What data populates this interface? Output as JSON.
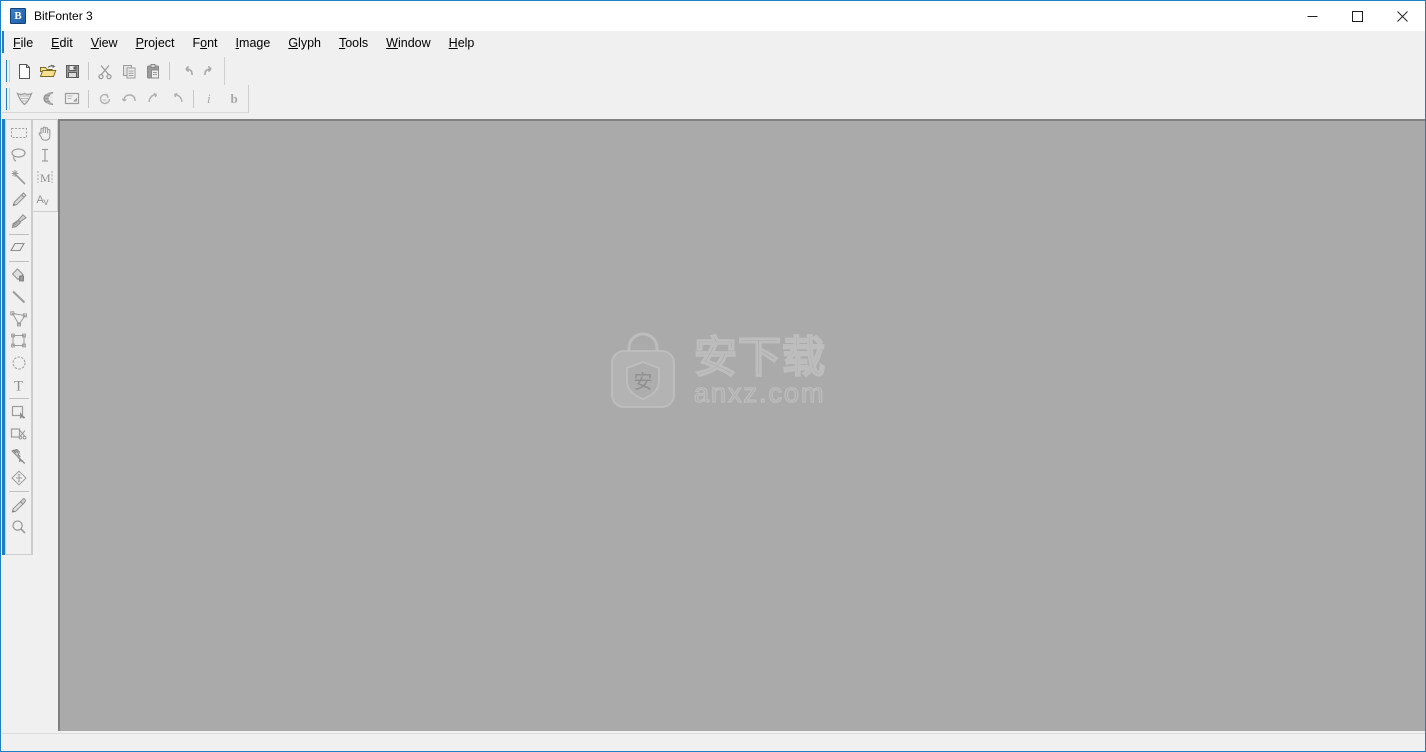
{
  "window": {
    "title": "BitFonter 3",
    "app_icon": "bitfonter-app-icon",
    "icon_letter": "B",
    "minimize_label": "Minimize",
    "maximize_label": "Maximize",
    "close_label": "Close",
    "accent_color": "#1f7fc4",
    "chrome_color": "#f0f0f0",
    "canvas_color": "#aaaaaa"
  },
  "menubar": {
    "items": [
      {
        "label": "File",
        "pre": "",
        "acc": "F",
        "post": "ile"
      },
      {
        "label": "Edit",
        "pre": "",
        "acc": "E",
        "post": "dit"
      },
      {
        "label": "View",
        "pre": "",
        "acc": "V",
        "post": "iew"
      },
      {
        "label": "Project",
        "pre": "",
        "acc": "P",
        "post": "roject"
      },
      {
        "label": "Font",
        "pre": "F",
        "acc": "o",
        "post": "nt"
      },
      {
        "label": "Image",
        "pre": "",
        "acc": "I",
        "post": "mage"
      },
      {
        "label": "Glyph",
        "pre": "",
        "acc": "G",
        "post": "lyph"
      },
      {
        "label": "Tools",
        "pre": "",
        "acc": "T",
        "post": "ools"
      },
      {
        "label": "Window",
        "pre": "",
        "acc": "W",
        "post": "indow"
      },
      {
        "label": "Help",
        "pre": "",
        "acc": "H",
        "post": "elp"
      }
    ]
  },
  "toolbar_main": {
    "buttons": [
      {
        "name": "new-document-icon",
        "label": "New",
        "enabled": true
      },
      {
        "name": "open-folder-icon",
        "label": "Open",
        "enabled": true
      },
      {
        "name": "save-disk-icon",
        "label": "Save",
        "enabled": true
      },
      {
        "name": "separator",
        "label": "",
        "enabled": false
      },
      {
        "name": "cut-scissors-icon",
        "label": "Cut",
        "enabled": false
      },
      {
        "name": "copy-icon",
        "label": "Copy",
        "enabled": false
      },
      {
        "name": "paste-clipboard-icon",
        "label": "Paste",
        "enabled": false
      },
      {
        "name": "separator",
        "label": "",
        "enabled": false
      },
      {
        "name": "undo-arrow-icon",
        "label": "Undo",
        "enabled": false
      },
      {
        "name": "redo-arrow-icon",
        "label": "Redo",
        "enabled": false
      }
    ]
  },
  "toolbar_glyph": {
    "buttons": [
      {
        "name": "font-window-icon",
        "label": "Font Window",
        "enabled": true
      },
      {
        "name": "glyph-window-icon",
        "label": "Glyph Window",
        "enabled": true
      },
      {
        "name": "preview-window-icon",
        "label": "Preview Window",
        "enabled": true
      },
      {
        "name": "separator",
        "label": "",
        "enabled": false
      },
      {
        "name": "rotate-180-icon",
        "label": "Rotate 180",
        "enabled": false
      },
      {
        "name": "flip-horizontal-icon",
        "label": "Flip Horizontal",
        "enabled": false
      },
      {
        "name": "rotate-cw-icon",
        "label": "Rotate Clockwise",
        "enabled": false
      },
      {
        "name": "rotate-ccw-icon",
        "label": "Rotate Counterclockwise",
        "enabled": false
      },
      {
        "name": "separator",
        "label": "",
        "enabled": false
      },
      {
        "name": "italic-icon",
        "label": "Italic",
        "enabled": false
      },
      {
        "name": "bold-icon",
        "label": "Bold",
        "enabled": false
      }
    ]
  },
  "tool_palette": {
    "column_left": [
      {
        "name": "marquee-select-tool",
        "label": "Rectangular Marquee"
      },
      {
        "name": "lasso-select-tool",
        "label": "Lasso"
      },
      {
        "name": "magic-wand-tool",
        "label": "Magic Wand"
      },
      {
        "name": "pencil-tool",
        "label": "Pencil"
      },
      {
        "name": "brush-tool",
        "label": "Brush"
      },
      {
        "name": "separator",
        "label": ""
      },
      {
        "name": "eraser-tool",
        "label": "Eraser"
      },
      {
        "name": "separator",
        "label": ""
      },
      {
        "name": "paint-bucket-tool",
        "label": "Paint Bucket"
      },
      {
        "name": "line-tool",
        "label": "Line"
      },
      {
        "name": "polygon-tool",
        "label": "Polygon"
      },
      {
        "name": "rectangle-tool",
        "label": "Rectangle"
      },
      {
        "name": "ellipse-tool",
        "label": "Ellipse"
      },
      {
        "name": "type-tool",
        "label": "Type"
      },
      {
        "name": "separator",
        "label": ""
      },
      {
        "name": "crop-select-tool",
        "label": "Crop Selection"
      },
      {
        "name": "cut-region-tool",
        "label": "Cut Region"
      },
      {
        "name": "smudge-tool",
        "label": "Smudge"
      },
      {
        "name": "transform-tool",
        "label": "Transform"
      },
      {
        "name": "separator",
        "label": ""
      },
      {
        "name": "eyedropper-tool",
        "label": "Eyedropper"
      },
      {
        "name": "zoom-tool",
        "label": "Zoom"
      }
    ],
    "column_right": [
      {
        "name": "hand-tool",
        "label": "Hand"
      },
      {
        "name": "text-cursor-tool",
        "label": "Text Cursor"
      },
      {
        "name": "metrics-tool",
        "label": "Metrics"
      },
      {
        "name": "kerning-tool",
        "label": "Kerning"
      }
    ]
  },
  "canvas": {
    "watermark": {
      "icon_name": "anxz-bag-logo",
      "badge_char": "安",
      "chinese_text": "安下载",
      "site_text": "anxz.com",
      "stroke_color": "#bdbdbd"
    }
  },
  "statusbar": {
    "text": ""
  }
}
